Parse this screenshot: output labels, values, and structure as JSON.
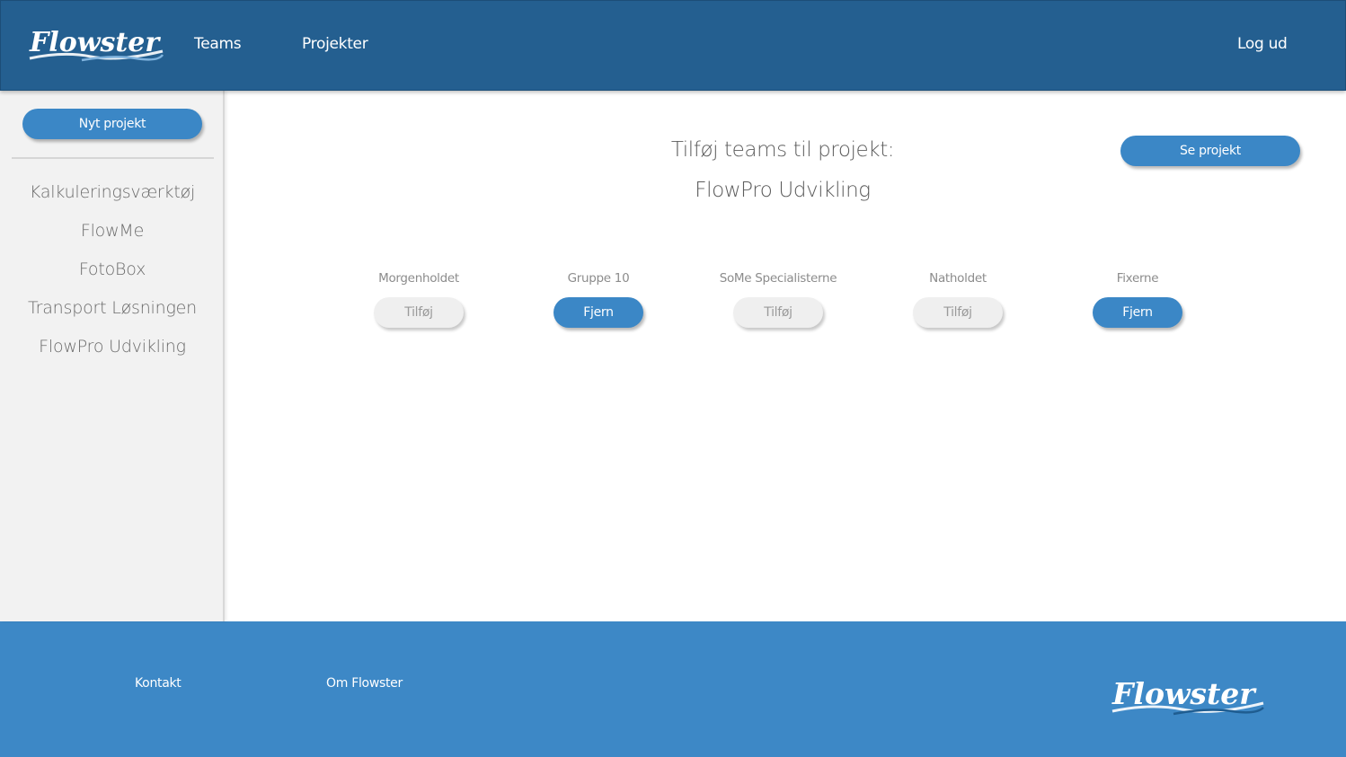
{
  "header": {
    "logo_text": "Flowster",
    "nav": [
      {
        "label": "Teams"
      },
      {
        "label": "Projekter"
      }
    ],
    "logout_label": "Log ud"
  },
  "sidebar": {
    "new_project_label": "Nyt projekt",
    "projects": [
      {
        "label": "Kalkuleringsværktøj"
      },
      {
        "label": "FlowMe"
      },
      {
        "label": "FotoBox"
      },
      {
        "label": "Transport Løsningen"
      },
      {
        "label": "FlowPro Udvikling"
      }
    ]
  },
  "main": {
    "title": "Tilføj teams til projekt:",
    "project_name": "FlowPro Udvikling",
    "view_project_label": "Se projekt",
    "teams": [
      {
        "name": "Morgenholdet",
        "action": "Tilføj",
        "assigned": false
      },
      {
        "name": "Gruppe 10",
        "action": "Fjern",
        "assigned": true
      },
      {
        "name": "SoMe Specialisterne",
        "action": "Tilføj",
        "assigned": false
      },
      {
        "name": "Natholdet",
        "action": "Tilføj",
        "assigned": false
      },
      {
        "name": "Fixerne",
        "action": "Fjern",
        "assigned": true
      }
    ]
  },
  "footer": {
    "links": [
      {
        "label": "Kontakt"
      },
      {
        "label": "Om Flowster"
      }
    ],
    "logo_text": "Flowster"
  },
  "colors": {
    "header_bg": "#245f90",
    "accent": "#3b87c6",
    "footer_bg": "#3d88c6",
    "sidebar_bg": "#f2f2f2"
  }
}
